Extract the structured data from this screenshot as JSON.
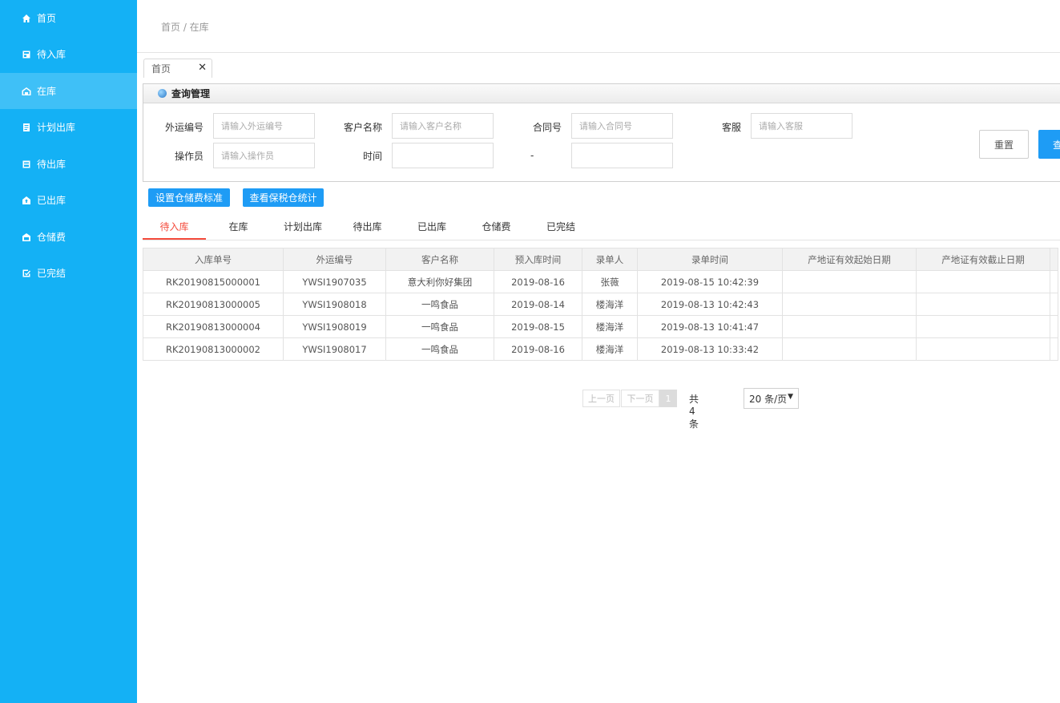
{
  "sidebar": {
    "items": [
      {
        "label": "首页",
        "icon": "home-icon"
      },
      {
        "label": "待入库",
        "icon": "inbox-icon"
      },
      {
        "label": "在库",
        "icon": "warehouse-icon"
      },
      {
        "label": "计划出库",
        "icon": "plan-icon"
      },
      {
        "label": "待出库",
        "icon": "pending-out-icon"
      },
      {
        "label": "已出库",
        "icon": "shipped-icon"
      },
      {
        "label": "仓储费",
        "icon": "fee-icon"
      },
      {
        "label": "已完结",
        "icon": "done-icon"
      }
    ],
    "active_index": 2,
    "bg_color": "#14b1f5"
  },
  "breadcrumb": "首页 / 在库",
  "page_tab": {
    "label": "首页",
    "close": "✕"
  },
  "query": {
    "title": "查询管理",
    "fields": {
      "waybill": {
        "label": "外运编号",
        "placeholder": "请输入外运编号"
      },
      "customer": {
        "label": "客户名称",
        "placeholder": "请输入客户名称"
      },
      "contract": {
        "label": "合同号",
        "placeholder": "请输入合同号"
      },
      "service": {
        "label": "客服",
        "placeholder": "请输入客服"
      },
      "operator": {
        "label": "操作员",
        "placeholder": "请输入操作员"
      },
      "time": {
        "label": "时间",
        "separator": "-"
      }
    },
    "reset_label": "重置",
    "query_label": "查"
  },
  "actions": {
    "set_fee_standard": "设置仓储费标准",
    "view_bonded_stats": "查看保税仓统计"
  },
  "tabs": [
    "待入库",
    "在库",
    "计划出库",
    "待出库",
    "已出库",
    "仓储费",
    "已完结"
  ],
  "active_tab": 0,
  "table": {
    "headers": [
      "入库单号",
      "外运编号",
      "客户名称",
      "预入库时间",
      "录单人",
      "录单时间",
      "产地证有效起始日期",
      "产地证有效截止日期",
      ""
    ],
    "rows": [
      [
        "RK20190815000001",
        "YWSI1907035",
        "意大利你好集团",
        "2019-08-16",
        "张薇",
        "2019-08-15 10:42:39",
        "",
        "",
        ""
      ],
      [
        "RK20190813000005",
        "YWSI1908018",
        "一鸣食品",
        "2019-08-14",
        "楼海洋",
        "2019-08-13 10:42:43",
        "",
        "",
        ""
      ],
      [
        "RK20190813000004",
        "YWSI1908019",
        "一鸣食品",
        "2019-08-15",
        "楼海洋",
        "2019-08-13 10:41:47",
        "",
        "",
        ""
      ],
      [
        "RK20190813000002",
        "YWSI1908017",
        "一鸣食品",
        "2019-08-16",
        "楼海洋",
        "2019-08-13 10:33:42",
        "",
        "",
        ""
      ]
    ]
  },
  "pager": {
    "prev": "上一页",
    "next": "下一页",
    "current": "1",
    "total": "共 4 条",
    "page_size": "20 条/页"
  }
}
